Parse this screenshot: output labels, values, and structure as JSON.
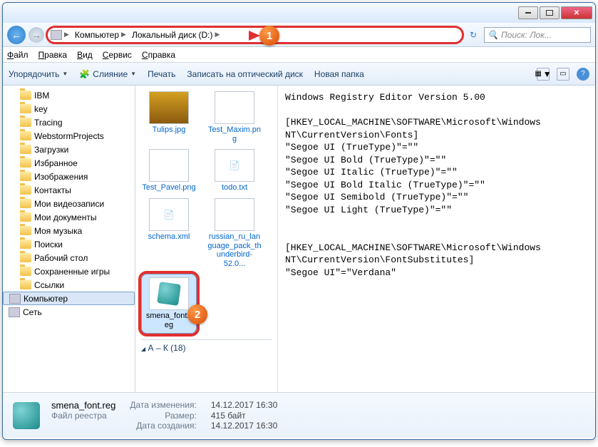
{
  "callouts": {
    "one": "1",
    "two": "2"
  },
  "address": {
    "root": "Компьютер",
    "drive": "Локальный диск (D:)"
  },
  "search": {
    "placeholder": "Поиск: Лок..."
  },
  "menu": {
    "file": "Файл",
    "edit": "Правка",
    "view": "Вид",
    "tools": "Сервис",
    "help": "Справка"
  },
  "toolbar": {
    "organize": "Упорядочить",
    "merge": "Слияние",
    "print": "Печать",
    "burn": "Записать на оптический диск",
    "newfolder": "Новая папка"
  },
  "sidebar": {
    "items": [
      "IBM",
      "key",
      "Tracing",
      "WebstormProjects",
      "Загрузки",
      "Избранное",
      "Изображения",
      "Контакты",
      "Мои видеозаписи",
      "Мои документы",
      "Моя музыка",
      "Поиски",
      "Рабочий стол",
      "Сохраненные игры",
      "Ссылки"
    ],
    "computer": "Компьютер",
    "network": "Сеть"
  },
  "files": {
    "items": [
      {
        "name": "Tulips.jpg"
      },
      {
        "name": "Test_Maxim.png"
      },
      {
        "name": "Test_Pavel.png"
      },
      {
        "name": "todo.txt"
      },
      {
        "name": "schema.xml"
      },
      {
        "name": "russian_ru_language_pack_thunderbird-52.0..."
      },
      {
        "name": "smena_font.reg"
      }
    ],
    "group": "А – К (18)"
  },
  "preview_text": "Windows Registry Editor Version 5.00\n\n[HKEY_LOCAL_MACHINE\\SOFTWARE\\Microsoft\\Windows NT\\CurrentVersion\\Fonts]\n\"Segoe UI (TrueType)\"=\"\"\n\"Segoe UI Bold (TrueType)\"=\"\"\n\"Segoe UI Italic (TrueType)\"=\"\"\n\"Segoe UI Bold Italic (TrueType)\"=\"\"\n\"Segoe UI Semibold (TrueType)\"=\"\"\n\"Segoe UI Light (TrueType)\"=\"\"\n\n\n[HKEY_LOCAL_MACHINE\\SOFTWARE\\Microsoft\\Windows NT\\CurrentVersion\\FontSubstitutes]\n\"Segoe UI\"=\"Verdana\"",
  "details": {
    "filename": "smena_font.reg",
    "filetype": "Файл реестра",
    "modified_label": "Дата изменения:",
    "modified": "14.12.2017 16:30",
    "size_label": "Размер:",
    "size": "415 байт",
    "created_label": "Дата создания:",
    "created": "14.12.2017 16:30"
  }
}
